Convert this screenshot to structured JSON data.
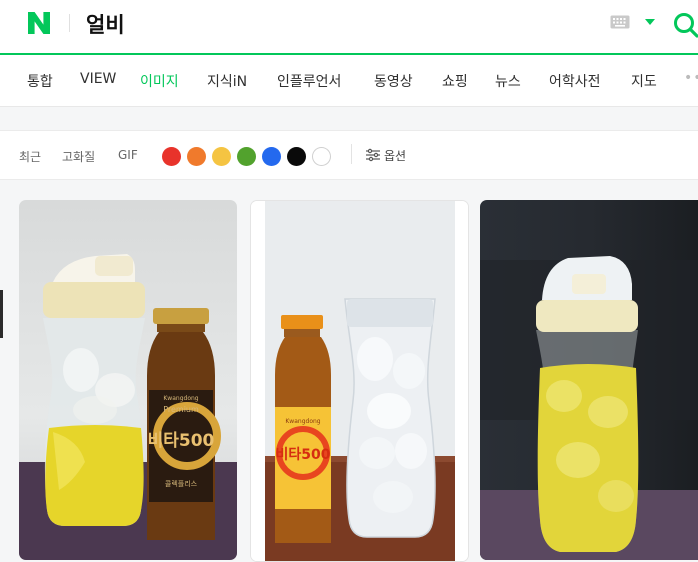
{
  "header": {
    "query": "얼비"
  },
  "tabs": [
    {
      "label": "통합"
    },
    {
      "label": "VIEW"
    },
    {
      "label": "이미지"
    },
    {
      "label": "지식iN"
    },
    {
      "label": "인플루언서"
    },
    {
      "label": "동영상"
    },
    {
      "label": "쇼핑"
    },
    {
      "label": "뉴스"
    },
    {
      "label": "어학사전"
    },
    {
      "label": "지도"
    }
  ],
  "active_tab": "이미지",
  "more_label": "••",
  "filters": {
    "recent": "최근",
    "hq": "고화질",
    "gif": "GIF",
    "options": "옵션"
  },
  "colors": [
    "#e8332b",
    "#f07a2c",
    "#f5c442",
    "#52a22d",
    "#2469ee",
    "#0a0a0a",
    "#ffffff"
  ],
  "brand_color": "#03c75a",
  "images": [
    {
      "label_top": "Premium",
      "label_brand": "비타500",
      "label_bottom": "콜렉플리스",
      "bottle_brand": "Kwangdong"
    },
    {
      "label_brand": "비타500",
      "bottle_brand": "Kwangdong"
    },
    {}
  ]
}
